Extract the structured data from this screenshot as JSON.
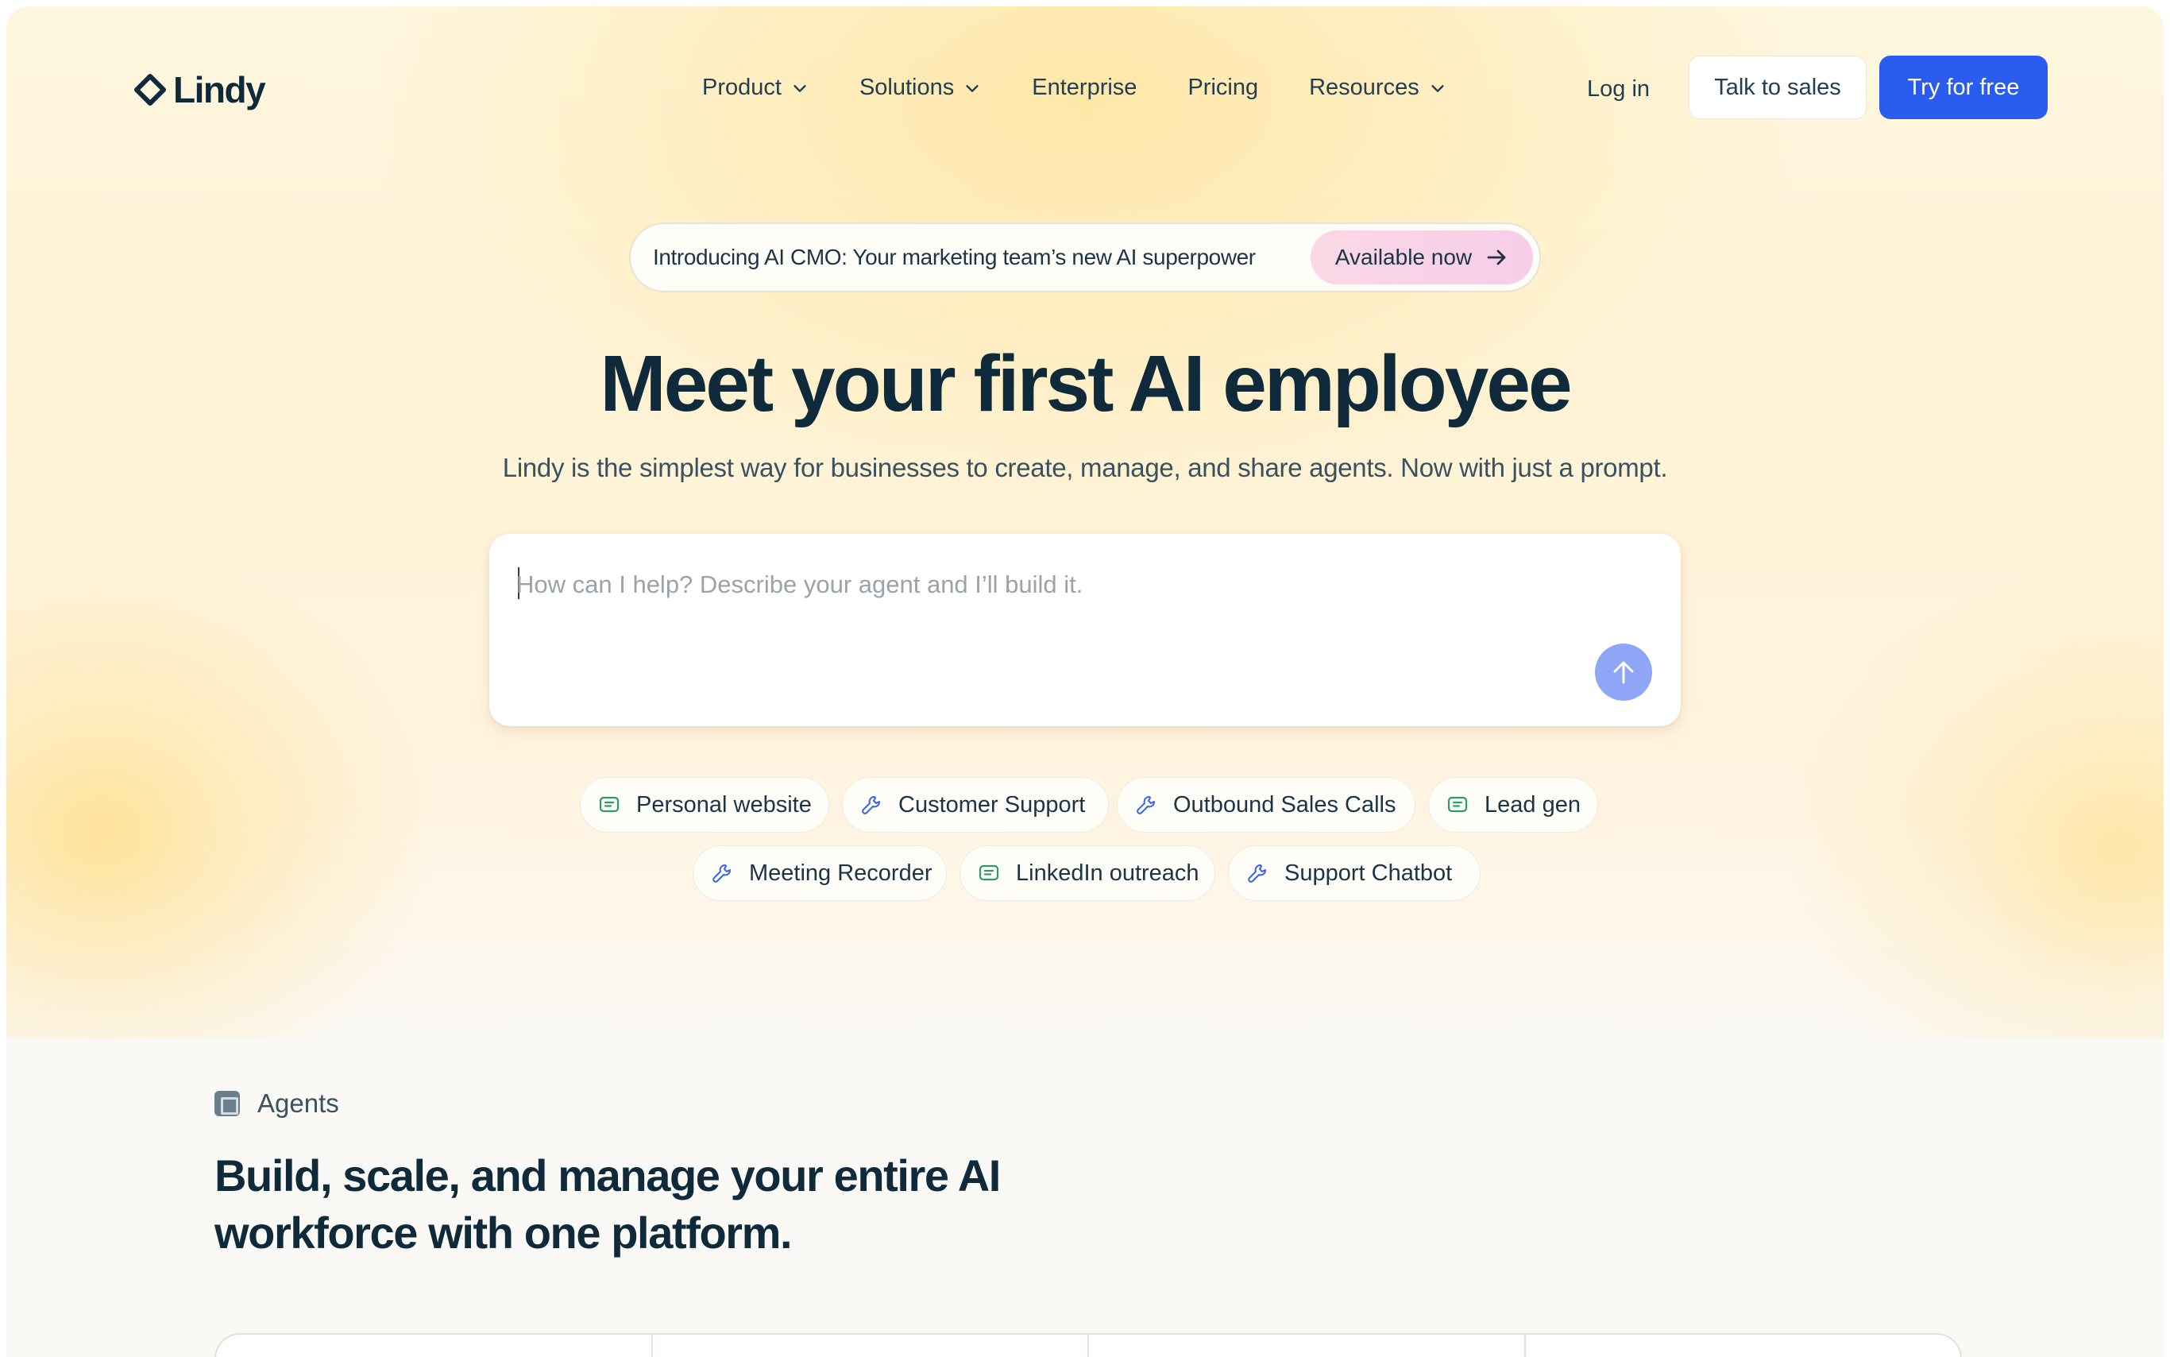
{
  "brand": {
    "name": "Lindy",
    "accent": "#2b5cf0"
  },
  "nav": {
    "links": [
      {
        "label": "Product",
        "dropdown": true
      },
      {
        "label": "Solutions",
        "dropdown": true
      },
      {
        "label": "Enterprise",
        "dropdown": false
      },
      {
        "label": "Pricing",
        "dropdown": false
      },
      {
        "label": "Resources",
        "dropdown": true
      }
    ],
    "login": "Log in",
    "talk_to_sales": "Talk to sales",
    "try_free": "Try for free"
  },
  "announcement": {
    "text": "Introducing AI CMO: Your marketing team’s new AI superpower",
    "pill": "Available now"
  },
  "hero": {
    "headline": "Meet your first AI employee",
    "subhead": "Lindy is the simplest way for businesses to create, manage, and share agents. Now with just a prompt."
  },
  "prompt": {
    "placeholder": "How can I help? Describe your agent and I’ll build it.",
    "value": ""
  },
  "chips": [
    {
      "label": "Personal website",
      "icon": "chat-icon"
    },
    {
      "label": "Customer Support",
      "icon": "wrench-icon"
    },
    {
      "label": "Outbound Sales Calls",
      "icon": "wrench-icon"
    },
    {
      "label": "Lead gen",
      "icon": "chat-icon"
    },
    {
      "label": "Meeting Recorder",
      "icon": "wrench-icon"
    },
    {
      "label": "LinkedIn outreach",
      "icon": "chat-icon"
    },
    {
      "label": "Support Chatbot",
      "icon": "wrench-icon"
    }
  ],
  "agents_section": {
    "label": "Agents",
    "title": "Build, scale, and manage your entire AI workforce with one platform."
  }
}
